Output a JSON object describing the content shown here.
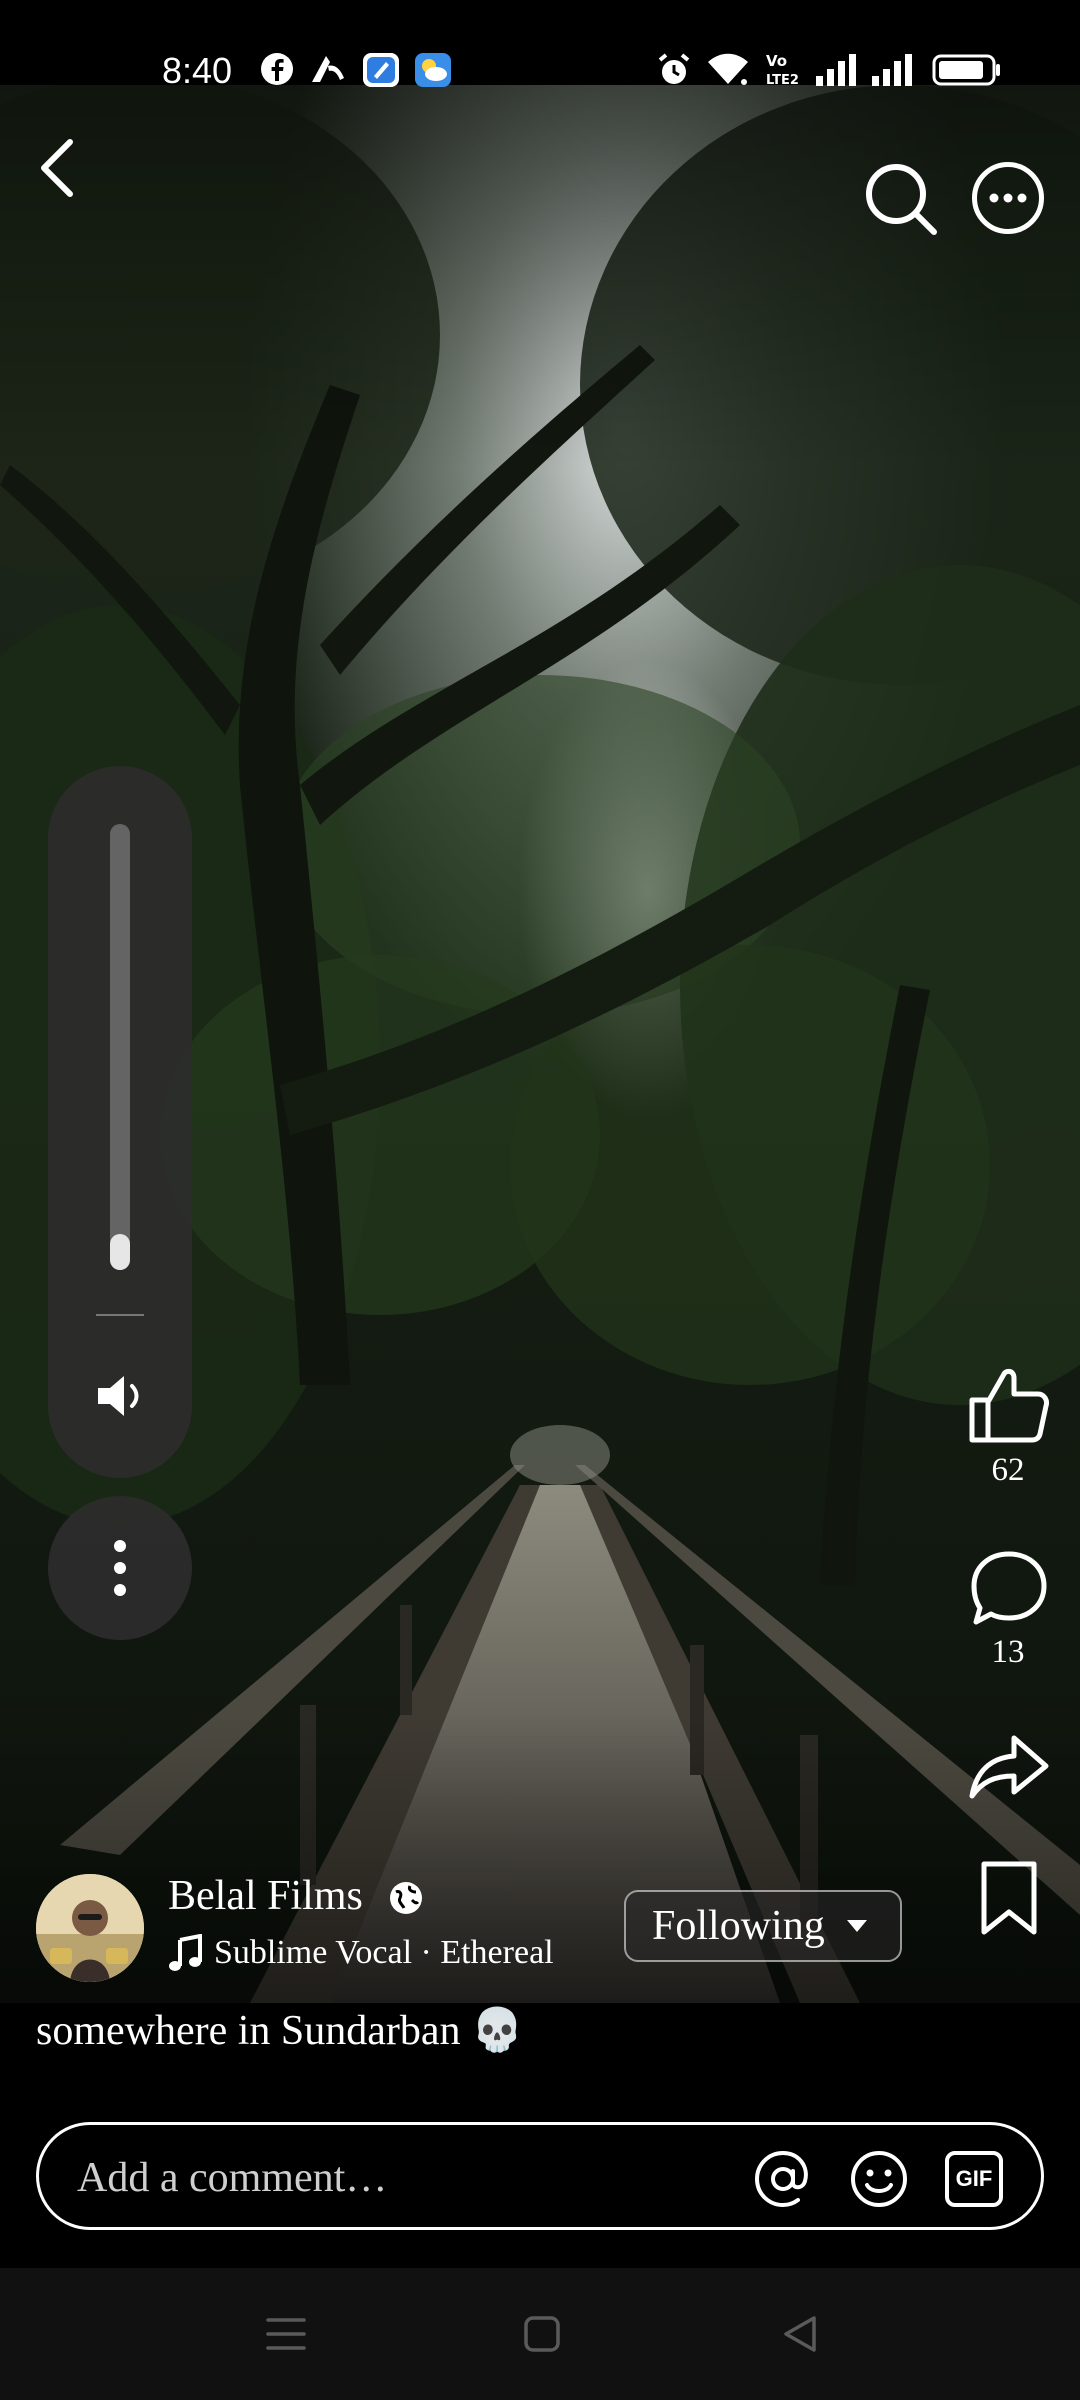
{
  "status_bar": {
    "time": "8:40",
    "left_icons": [
      "facebook-icon",
      "network-operator-icon",
      "app-notification-icon",
      "weather-icon"
    ],
    "right_icons": [
      "alarm-icon",
      "wifi-icon",
      "volte-icon",
      "signal-icon",
      "signal-icon",
      "battery-icon"
    ],
    "volte_label": "Vo LTE2"
  },
  "header": {
    "back_icon": "chevron-left-icon",
    "search_icon": "search-icon",
    "more_icon": "more-horizontal-icon"
  },
  "volume": {
    "level": 0.08,
    "speaker_icon": "speaker-icon",
    "more_icon": "more-vertical-icon"
  },
  "actions": {
    "like_count": "62",
    "comment_count": "13",
    "like_icon": "thumbs-up-icon",
    "comment_icon": "comment-icon",
    "share_icon": "share-icon",
    "save_icon": "bookmark-icon",
    "more_icon": "more-horizontal-icon"
  },
  "post": {
    "author": "Belal Films",
    "audience_icon": "globe-icon",
    "audio": "Sublime Vocal · Ethereal",
    "audio_icon": "music-note-icon",
    "follow_label": "Following",
    "caption": "somewhere in Sundarban 💀"
  },
  "comment_bar": {
    "placeholder": "Add a comment…",
    "mention_icon": "at-icon",
    "emoji_icon": "emoji-icon",
    "gif_label": "GIF"
  },
  "nav_bar": {
    "icons": [
      "menu-icon",
      "home-icon",
      "back-icon"
    ]
  },
  "colors": {
    "background": "#000000",
    "text": "#ffffff",
    "panel": "#2d2d2d"
  }
}
